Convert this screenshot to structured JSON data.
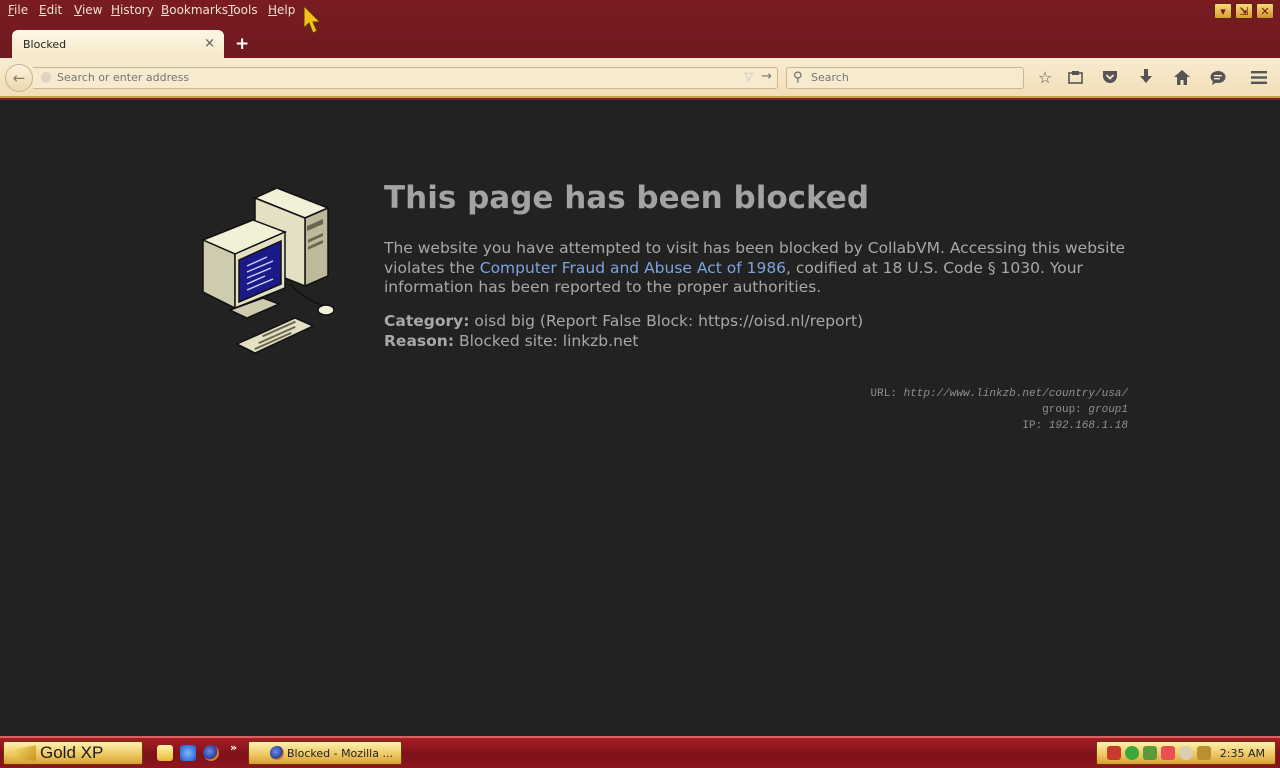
{
  "menu": [
    "File",
    "Edit",
    "View",
    "History",
    "Bookmarks",
    "Tools",
    "Help"
  ],
  "tab": {
    "title": "Blocked",
    "close": "×",
    "new_tab": "+"
  },
  "navbar": {
    "url_placeholder": "Search or enter address",
    "search_placeholder": "Search"
  },
  "window_controls": {
    "minimize": "▾",
    "restore": "⇲",
    "close": "✕"
  },
  "page": {
    "heading": "This page has been blocked",
    "intro_before": "The website you have attempted to visit has been blocked by CollabVM. Accessing this website violates the ",
    "intro_link": "Computer Fraud and Abuse Act of 1986",
    "intro_after": ", codified at 18 U.S. Code § 1030. Your information has been reported to the proper authorities.",
    "category_label": "Category:",
    "category_value": " oisd big (Report False Block: https://oisd.nl/report)",
    "reason_label": "Reason:",
    "reason_value": " Blocked site: linkzb.net",
    "url_label": "URL: ",
    "url_value": "http://www.linkzb.net/country/usa/",
    "group_label": "group: ",
    "group_value": "group1",
    "ip_label": "IP: ",
    "ip_value": "192.168.1.18"
  },
  "taskbar": {
    "start_label": "Gold XP",
    "quicklaunch_more": "»",
    "task_label": "Blocked - Mozilla ...",
    "clock": "2:35 AM"
  },
  "colors": {
    "chrome": "#7a1b22",
    "page_bg": "#222222",
    "heading": "#a3a3a3",
    "link": "#7ea3de",
    "taskbar_gold": "#ecc560"
  }
}
